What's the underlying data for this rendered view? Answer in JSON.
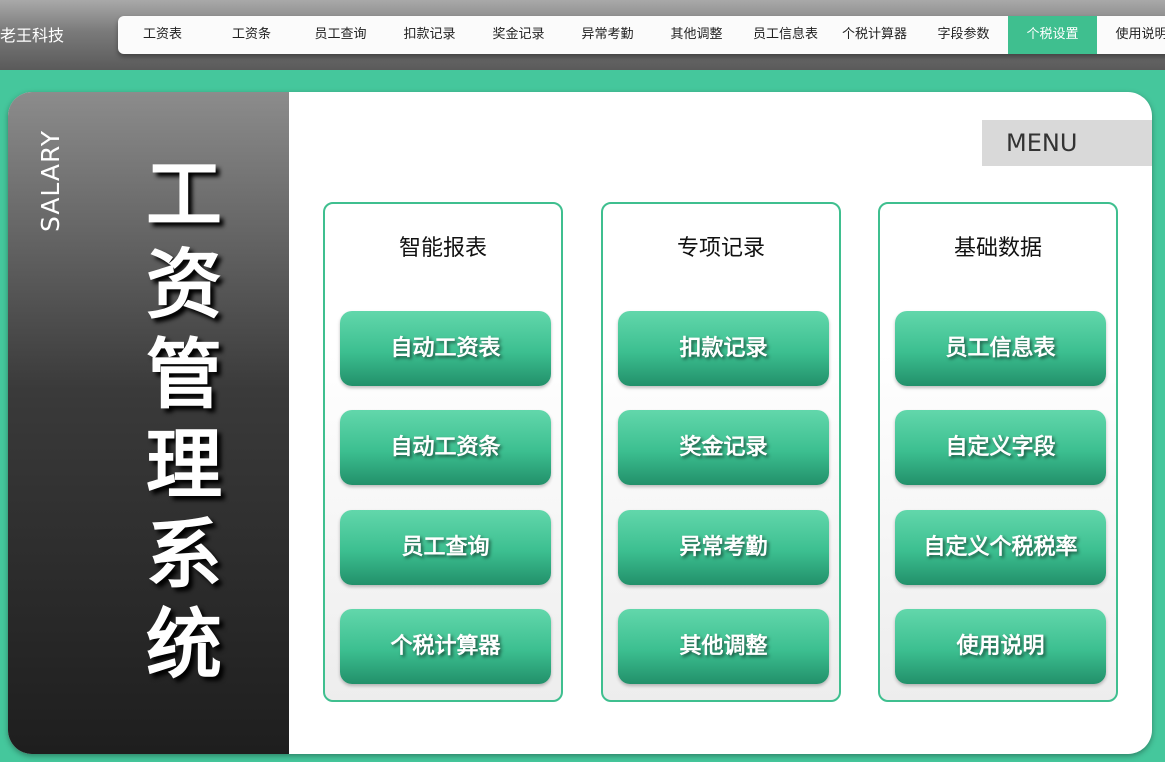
{
  "brand": "老王科技",
  "nav_tabs": [
    {
      "label": "工资表",
      "active": false
    },
    {
      "label": "工资条",
      "active": false
    },
    {
      "label": "员工查询",
      "active": false
    },
    {
      "label": "扣款记录",
      "active": false
    },
    {
      "label": "奖金记录",
      "active": false
    },
    {
      "label": "异常考勤",
      "active": false
    },
    {
      "label": "其他调整",
      "active": false
    },
    {
      "label": "员工信息表",
      "active": false
    },
    {
      "label": "个税计算器",
      "active": false
    },
    {
      "label": "字段参数",
      "active": false
    },
    {
      "label": "个税设置",
      "active": true
    },
    {
      "label": "使用说明",
      "active": false
    }
  ],
  "sidebar": {
    "subtitle": "SALARY",
    "title_chars": [
      "工",
      "资",
      "管",
      "理",
      "系",
      "统"
    ]
  },
  "menu_label": "MENU",
  "columns": [
    {
      "title": "智能报表",
      "buttons": [
        "自动工资表",
        "自动工资条",
        "员工查询",
        "个税计算器"
      ]
    },
    {
      "title": "专项记录",
      "buttons": [
        "扣款记录",
        "奖金记录",
        "异常考勤",
        "其他调整"
      ]
    },
    {
      "title": "基础数据",
      "buttons": [
        "员工信息表",
        "自定义字段",
        "自定义个税税率",
        "使用说明"
      ]
    }
  ],
  "colors": {
    "accent": "#3fbf8f",
    "page_background": "#45c79c",
    "sidebar_dark": "#1e1e1e"
  }
}
